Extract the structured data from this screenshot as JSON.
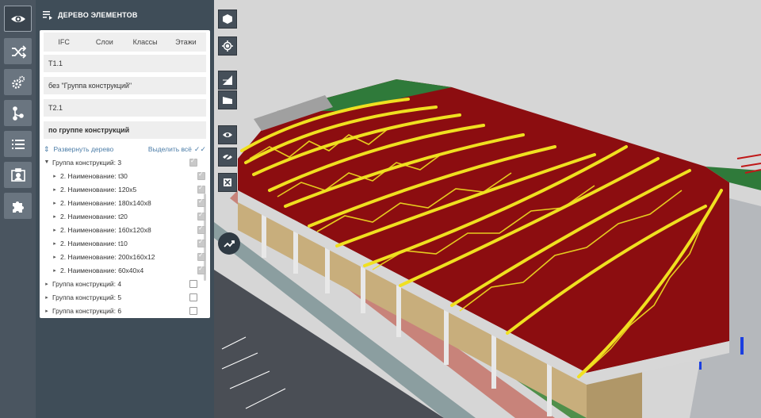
{
  "panel": {
    "title": "ДЕРЕВО ЭЛЕМЕНТОВ",
    "tabs": [
      "IFC",
      "Слои",
      "Классы",
      "Этажи"
    ],
    "groups": [
      "T1.1",
      "без \"Группа конструкций\"",
      "T2.1",
      "по группе конструкций"
    ],
    "expand_label": "Развернуть дерево",
    "select_all_label": "Выделить всё",
    "tree": [
      {
        "label": "Группа конструкций: 3",
        "caret": "▼",
        "checked": true
      },
      {
        "label": "2. Наименование: t30",
        "caret": "▸",
        "checked": true
      },
      {
        "label": "2. Наименование: 120x5",
        "caret": "▸",
        "checked": true
      },
      {
        "label": "2. Наименование: 180x140x8",
        "caret": "▸",
        "checked": true
      },
      {
        "label": "2. Наименование: t20",
        "caret": "▸",
        "checked": true
      },
      {
        "label": "2. Наименование: 160x120x8",
        "caret": "▸",
        "checked": true
      },
      {
        "label": "2. Наименование: t10",
        "caret": "▸",
        "checked": true
      },
      {
        "label": "2. Наименование: 200x160x12",
        "caret": "▸",
        "checked": true
      },
      {
        "label": "2. Наименование: 60x40x4",
        "caret": "▸",
        "checked": true
      },
      {
        "label": "Группа конструкций: 4",
        "caret": "▸",
        "checked": false
      },
      {
        "label": "Группа конструкций: 5",
        "caret": "▸",
        "checked": false
      },
      {
        "label": "Группа конструкций: 6",
        "caret": "▸",
        "checked": false
      }
    ]
  },
  "rail": {
    "icons": [
      "eye-icon",
      "shuffle-icon",
      "gears-icon",
      "branch-icon",
      "list-icon",
      "badge-icon",
      "puzzle-icon"
    ]
  },
  "viewport": {
    "tools": [
      "cube-icon",
      "target-icon",
      "section-icon",
      "clip-box-icon",
      "show-icon",
      "hide-icon",
      "isolate-icon"
    ]
  }
}
